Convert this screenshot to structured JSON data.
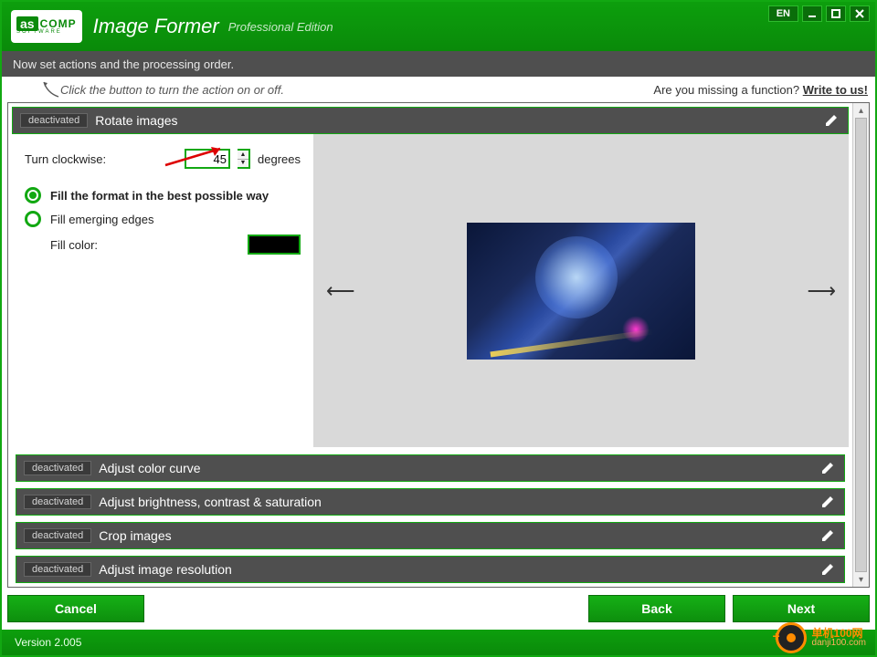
{
  "titlebar": {
    "logo_as": "as",
    "logo_comp": "COMP",
    "logo_sub": "SOFTWARE",
    "app_title": "Image Former",
    "app_edition": "Professional Edition",
    "lang": "EN"
  },
  "instruction": "Now set actions and the processing order.",
  "hint": {
    "text": "Click the button to turn the action on or off.",
    "right_prefix": "Are you missing a function? ",
    "right_link": "Write to us!"
  },
  "actions": {
    "rotate": {
      "badge": "deactivated",
      "title": "Rotate images",
      "turn_label": "Turn clockwise:",
      "turn_value": "45",
      "turn_unit": "degrees",
      "opt_fill_format": "Fill the format in the best possible way",
      "opt_fill_edges": "Fill emerging edges",
      "fill_color_label": "Fill color:",
      "fill_color": "#000000"
    },
    "collapsed": [
      {
        "badge": "deactivated",
        "title": "Adjust color curve"
      },
      {
        "badge": "deactivated",
        "title": "Adjust brightness, contrast & saturation"
      },
      {
        "badge": "deactivated",
        "title": "Crop images"
      },
      {
        "badge": "deactivated",
        "title": "Adjust image resolution"
      }
    ]
  },
  "buttons": {
    "cancel": "Cancel",
    "back": "Back",
    "next": "Next"
  },
  "status": {
    "version": "Version 2.005"
  },
  "watermark": {
    "cn": "单机100网",
    "url": "danji100.com"
  }
}
